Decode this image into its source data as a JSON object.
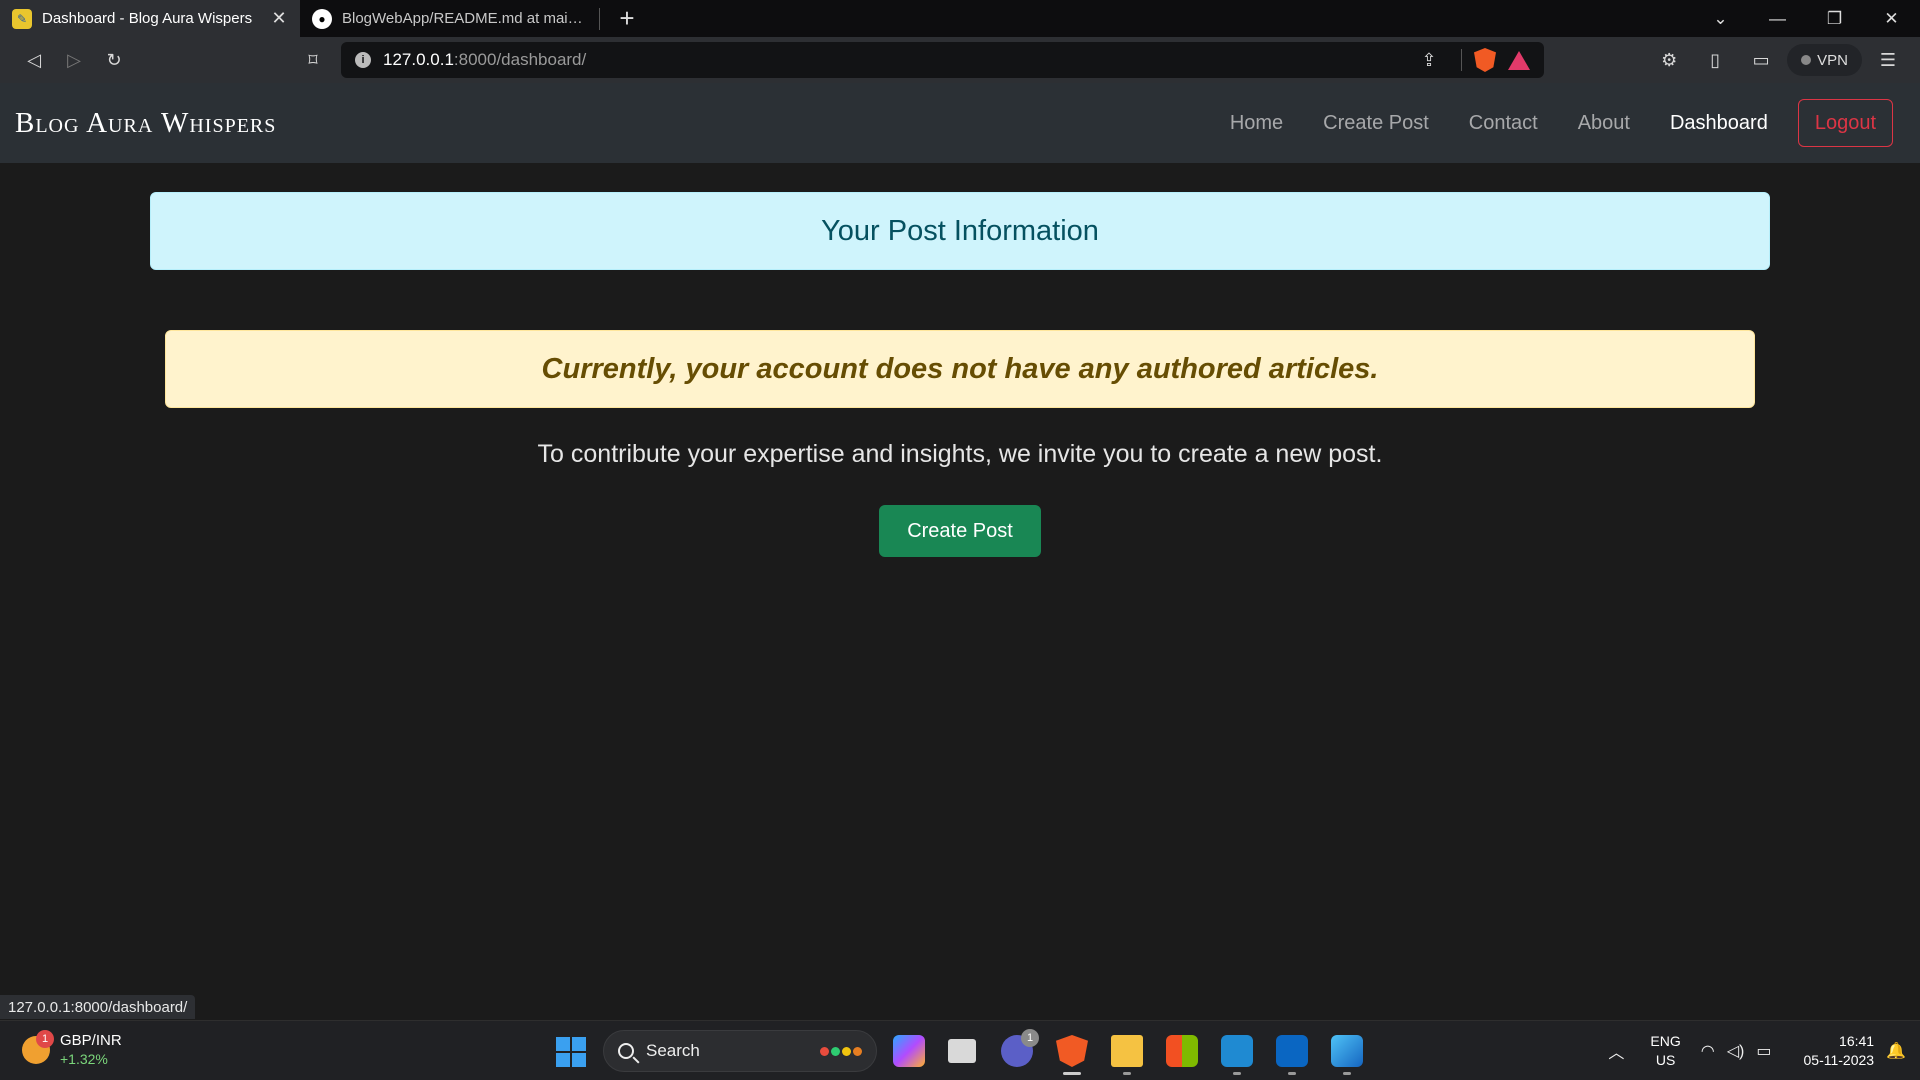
{
  "browser": {
    "tabs": [
      {
        "title": "Dashboard - Blog Aura Wispers",
        "active": true
      },
      {
        "title": "BlogWebApp/README.md at main · A",
        "active": false
      }
    ],
    "url_host": "127.0.0.1",
    "url_path": ":8000/dashboard/",
    "vpn_label": "VPN",
    "status_url": "127.0.0.1:8000/dashboard/"
  },
  "navbar": {
    "brand": "Blog Aura Whispers",
    "links": [
      "Home",
      "Create Post",
      "Contact",
      "About",
      "Dashboard"
    ],
    "active_link": "Dashboard",
    "logout_label": "Logout"
  },
  "main": {
    "info_title": "Your Post Information",
    "warning_text": "Currently, your account does not have any authored articles.",
    "invite_text": "To contribute your expertise and insights, we invite you to create a new post.",
    "create_button": "Create Post"
  },
  "taskbar": {
    "ticker_name": "GBP/INR",
    "ticker_change": "+1.32%",
    "ticker_badge": "1",
    "search_label": "Search",
    "chat_badge": "1",
    "lang_line1": "ENG",
    "lang_line2": "US",
    "time": "16:41",
    "date": "05-11-2023"
  },
  "colors": {
    "info_bg": "#cff4fc",
    "info_text": "#055160",
    "warning_bg": "#fff3cd",
    "warning_text": "#664d03",
    "success": "#198754",
    "danger": "#dc3545",
    "navbar_bg": "#2b3035",
    "page_bg": "#1b1b1b"
  }
}
